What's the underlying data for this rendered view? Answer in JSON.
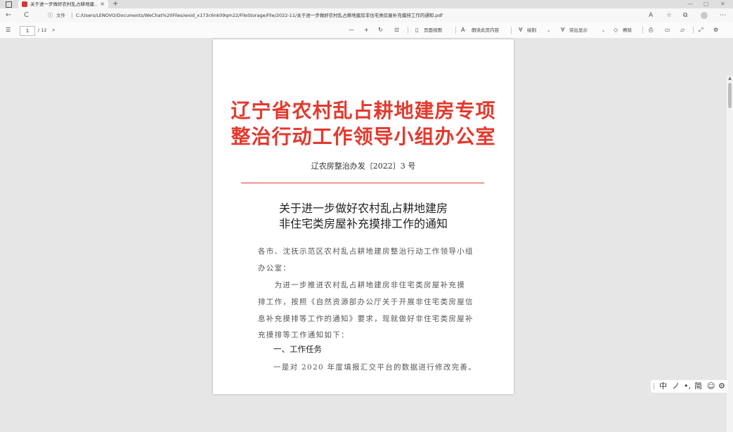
{
  "browser": {
    "tab_title": "关于进一步做好农村乱占耕地建...",
    "tab_close": "×",
    "new_tab": "+",
    "window_controls": [
      "—",
      "▢",
      "✕"
    ],
    "address_info_label": "文件",
    "address_url": "C:/Users/LENOVO/Documents/WeChat%20Files/wxid_x173c6nk09qm22/FileStorage/File/2022-11/关于进一步做好农村乱占耕地建房非住宅类房屋补充摸排工作的通知.pdf",
    "nav_back": "←",
    "nav_refresh": "C"
  },
  "pdf_toolbar": {
    "page_current": "1",
    "page_total": "/ 12",
    "zoom_out": "—",
    "zoom_in": "+",
    "page_view": "页面视图",
    "read_aloud": "朗读此页内容",
    "draw": "绘制",
    "highlight": "突出显示",
    "erase": "擦除"
  },
  "document": {
    "org_line1": "辽宁省农村乱占耕地建房专项",
    "org_line2": "整治行动工作领导小组办公室",
    "doc_number": "辽农房整治办发〔2022〕3 号",
    "title_line1": "关于进一步做好农村乱占耕地建房",
    "title_line2": "非住宅类房屋补充摸排工作的通知",
    "body_lines": [
      "各市、沈抚示范区农村乱占耕地建房整治行动工作领导小组",
      "办公室：",
      "　　为进一步推进农村乱占耕地建房非住宅类房屋补充摸",
      "排工作，按照《自然资源部办公厅关于开展非住宅类房屋信",
      "息补充摸排等工作的通知》要求，现就做好非住宅类房屋补",
      "充摸排等工作通知如下："
    ],
    "section_heading": "一、工作任务",
    "section_line": "一是对 2020 年度填报汇交平台的数据进行修改完善。"
  },
  "ime_bar": {
    "items": [
      "中",
      "ノ",
      "•,",
      "简",
      "☺",
      "⚙"
    ]
  },
  "colors": {
    "red_header": "#e23a2e",
    "page_bg": "#ffffff",
    "viewer_bg": "#e6e6e6"
  }
}
